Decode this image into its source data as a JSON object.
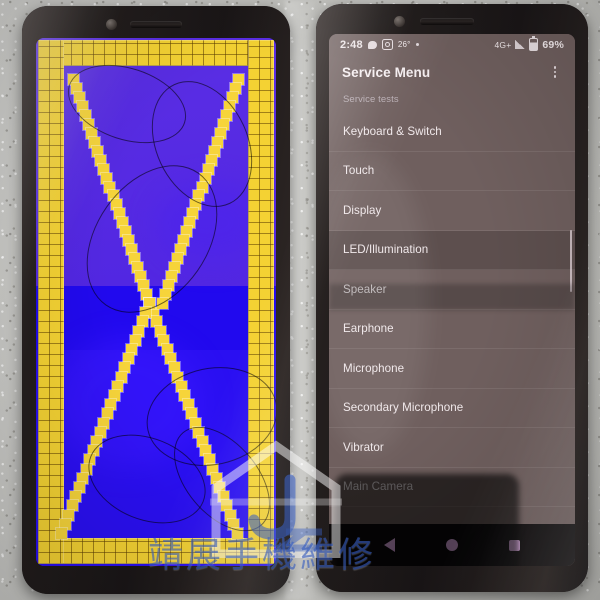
{
  "scene": {
    "description": "Two smartphones side by side on a stone surface; left shows a yellow grid display test pattern on blue, right shows the Service Menu diagnostics list"
  },
  "left_phone": {
    "test_pattern": {
      "name": "display-test-pattern",
      "grid_color": "#f4d233",
      "background_colors": [
        "#5a2ee4",
        "#2109ee",
        "#2a0ff2"
      ]
    }
  },
  "right_phone": {
    "statusbar": {
      "clock": "2:48",
      "temperature": "26°",
      "network": "4G+",
      "battery_percent": "69%",
      "icons": [
        "message-icon",
        "camera-icon",
        "dot-icon",
        "signal-icon",
        "battery-icon"
      ]
    },
    "appbar": {
      "title": "Service Menu",
      "overflow_icon": "more-vertical-icon"
    },
    "section_header": "Service tests",
    "list_items": [
      {
        "label": "Keyboard & Switch",
        "highlighted": false
      },
      {
        "label": "Touch",
        "highlighted": false
      },
      {
        "label": "Display",
        "highlighted": false
      },
      {
        "label": "LED/Illumination",
        "highlighted": true
      },
      {
        "label": "Speaker",
        "highlighted": false
      },
      {
        "label": "Earphone",
        "highlighted": false
      },
      {
        "label": "Microphone",
        "highlighted": false
      },
      {
        "label": "Secondary Microphone",
        "highlighted": false
      },
      {
        "label": "Vibrator",
        "highlighted": false
      },
      {
        "label": "Main Camera",
        "highlighted": false
      }
    ],
    "navbar": {
      "back": "back-triangle-icon",
      "home": "home-circle-icon",
      "recents": "recents-square-icon",
      "accent_color": "#e9b3ee"
    }
  },
  "watermark": {
    "text": "靖展手機維修",
    "logo": "house-jz-logo",
    "color": "#3b63c9"
  }
}
